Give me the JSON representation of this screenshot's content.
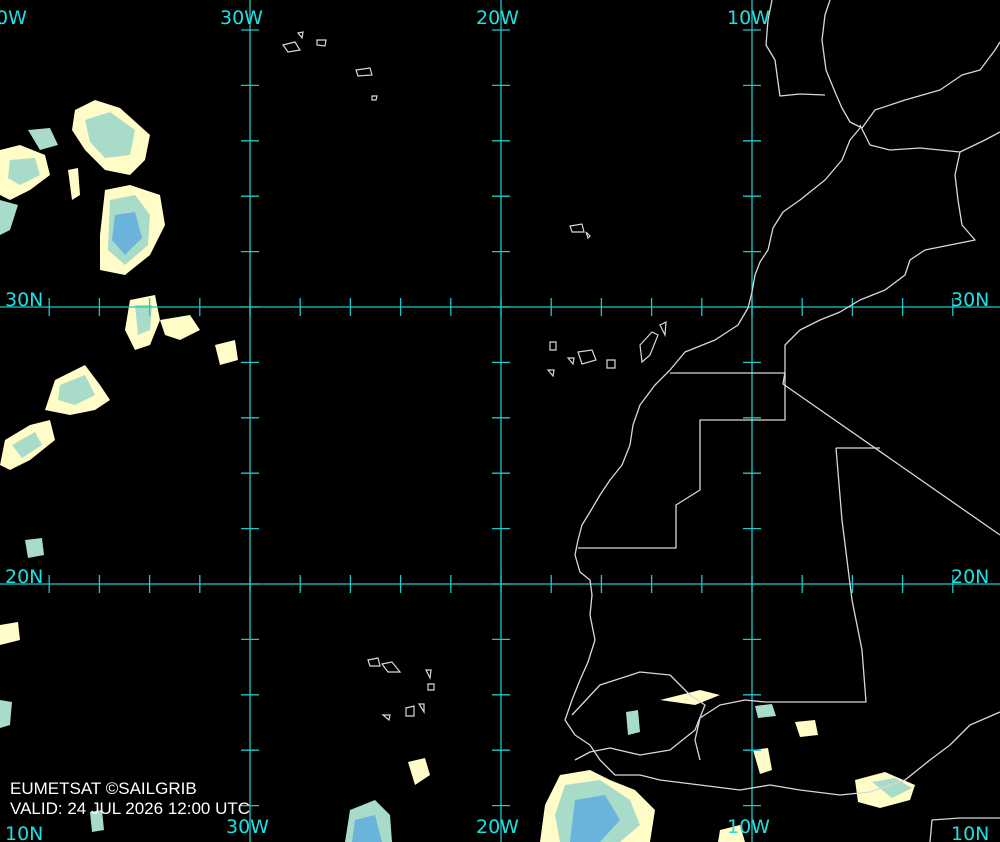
{
  "grid_labels": {
    "top_30w": "30W",
    "top_20w": "20W",
    "top_10w": "10W",
    "top_edge": "0W",
    "bottom_30w": "30W",
    "bottom_20w": "20W",
    "bottom_10w": "10W",
    "bottom_left_edge": "10N",
    "left_30n": "30N",
    "left_20n": "20N",
    "right_30n": "30N",
    "right_20n": "20N",
    "right_10n": "10N"
  },
  "credit": {
    "source": "EUMETSAT ©SAILGRIB",
    "valid": "VALID:  24 JUL 2026 12:00 UTC"
  },
  "colors": {
    "background": "#000000",
    "graticule": "#1ec8c8",
    "coastline": "#d8d8d8",
    "cloud_low": "#fffcc8",
    "cloud_mid": "#a8dcc8",
    "cloud_high": "#6ab4dc"
  }
}
